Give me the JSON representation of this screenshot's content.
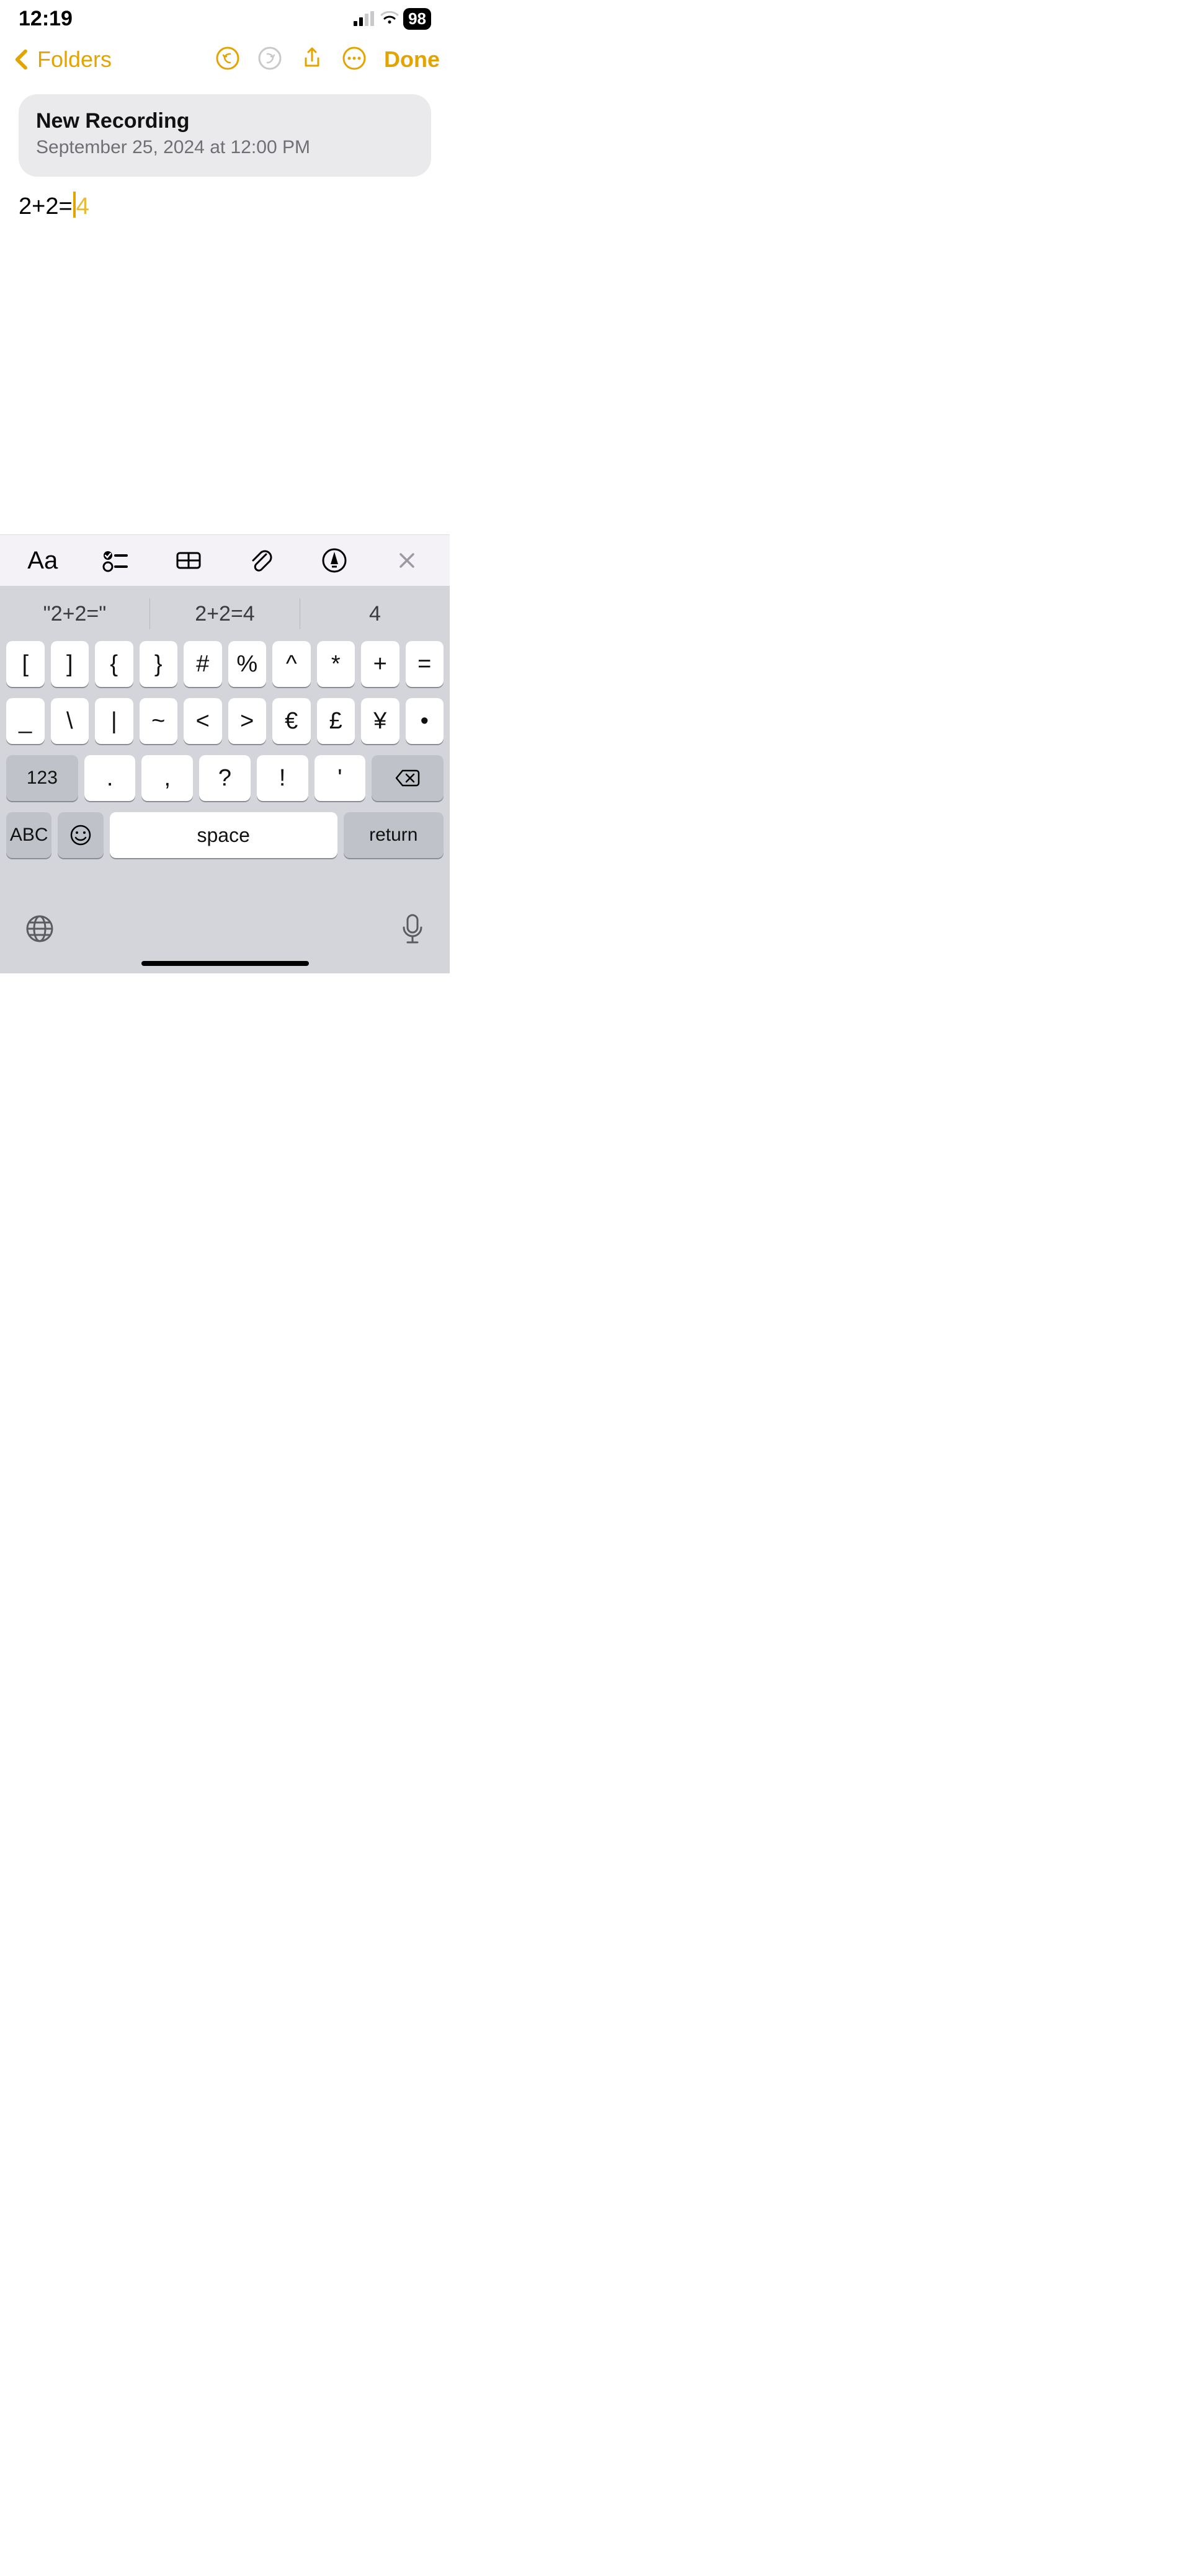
{
  "status": {
    "time": "12:19",
    "battery": "98"
  },
  "nav": {
    "back": "Folders",
    "done": "Done"
  },
  "recording": {
    "title": "New Recording",
    "subtitle": "September 25, 2024 at 12:00 PM"
  },
  "note": {
    "typed": "2+2=",
    "suggestion": "4"
  },
  "suggestions": [
    "\"2+2=\"",
    "2+2=4",
    "4"
  ],
  "keys": {
    "row1": [
      "[",
      "]",
      "{",
      "}",
      "#",
      "%",
      "^",
      "*",
      "+",
      "="
    ],
    "row2": [
      "_",
      "\\",
      "|",
      "~",
      "<",
      ">",
      "€",
      "£",
      "¥",
      "•"
    ],
    "row3_num": "123",
    "row3_keys": [
      ".",
      ",",
      "?",
      "!",
      "'"
    ],
    "abc": "ABC",
    "space": "space",
    "return": "return"
  },
  "format_icons": [
    "Aa"
  ],
  "icons": {
    "signal": "signal-icon",
    "wifi": "wifi-icon",
    "undo": "undo-icon",
    "redo": "redo-icon",
    "share": "share-icon",
    "more": "more-icon",
    "fmt_text": "text-format-icon",
    "fmt_checklist": "checklist-icon",
    "fmt_table": "table-icon",
    "fmt_attach": "attachment-icon",
    "fmt_handwrite": "handwriting-icon",
    "fmt_close": "close-icon",
    "globe": "globe-icon",
    "mic": "mic-icon",
    "backspace": "backspace-icon",
    "emoji": "emoji-icon"
  }
}
